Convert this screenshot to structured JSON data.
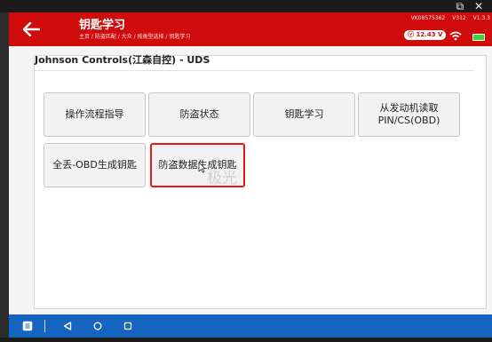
{
  "header": {
    "title": "钥匙学习",
    "breadcrumb": "主页 / 防盗匹配 / 大众 / 按类型选择 / 钥匙学习",
    "serial": "VK08575362",
    "version_a": "V312",
    "version_b": "V1.3.3",
    "voltage": "12.43 V",
    "accent_color": "#cf0b0b"
  },
  "main": {
    "section_title": "Johnson Controls(江森自控) - UDS",
    "buttons": [
      {
        "label": "操作流程指导"
      },
      {
        "label": "防盗状态"
      },
      {
        "label": "钥匙学习"
      },
      {
        "label": "从发动机读取PIN/CS(OBD)"
      },
      {
        "label": "全丢-OBD生成钥匙"
      },
      {
        "label": "防盗数据生成钥匙",
        "selected": true
      }
    ],
    "watermark": "极光"
  },
  "device": {
    "top_icons": "⧉ ✕"
  },
  "navbar": {
    "color": "#1565c0",
    "icons": [
      "app-switch-icon",
      "back-triangle-icon",
      "home-circle-icon",
      "recents-square-icon"
    ]
  }
}
